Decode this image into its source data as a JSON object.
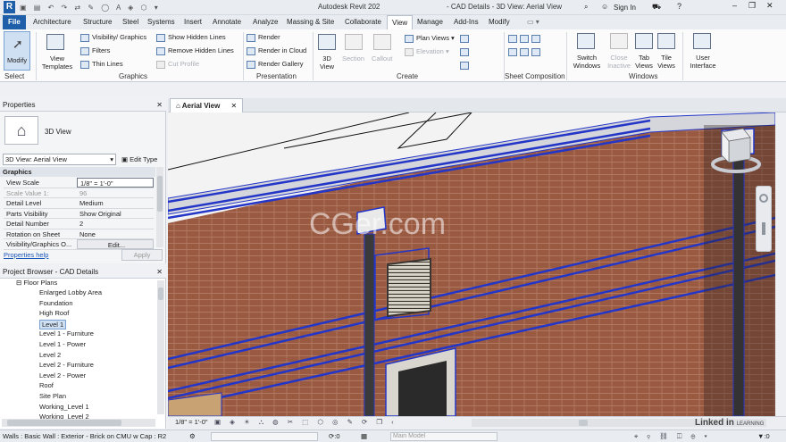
{
  "app": {
    "title": "Autodesk Revit 202",
    "doc_title": "- CAD Details - 3D View: Aerial View",
    "sign_in": "Sign In",
    "logo": "R"
  },
  "ribbon_tabs": [
    "File",
    "Architecture",
    "Structure",
    "Steel",
    "Systems",
    "Insert",
    "Annotate",
    "Analyze",
    "Massing & Site",
    "Collaborate",
    "View",
    "Manage",
    "Add-Ins",
    "Modify"
  ],
  "ribbon": {
    "modify": "Modify",
    "select": "Select",
    "view_templates": "View Templates",
    "visibility_graphics": "Visibility/ Graphics",
    "filters": "Filters",
    "thin_lines": "Thin Lines",
    "show_hidden_lines": "Show Hidden Lines",
    "remove_hidden_lines": "Remove Hidden Lines",
    "cut_profile": "Cut Profile",
    "graphics_label": "Graphics",
    "render": "Render",
    "render_in_cloud": "Render in Cloud",
    "render_gallery": "Render Gallery",
    "presentation_label": "Presentation",
    "view_3d": "3D View",
    "section": "Section",
    "callout": "Callout",
    "plan_views": "Plan Views",
    "elevation": "Elevation",
    "create_label": "Create",
    "sheet_composition_label": "Sheet Composition",
    "switch_windows": "Switch Windows",
    "close_inactive": "Close Inactive",
    "tab_views": "Tab Views",
    "tile_views": "Tile Views",
    "windows_label": "Windows",
    "user_interface": "User Interface"
  },
  "properties": {
    "title": "Properties",
    "type_name": "3D View",
    "selector": "3D View: Aerial View",
    "edit_type": "Edit Type",
    "group": "Graphics",
    "rows": [
      {
        "key": "View Scale",
        "value": "1/8\" = 1'-0\""
      },
      {
        "key": "Scale Value    1:",
        "value": "96"
      },
      {
        "key": "Detail Level",
        "value": "Medium"
      },
      {
        "key": "Parts Visibility",
        "value": "Show Original"
      },
      {
        "key": "Detail Number",
        "value": "2"
      },
      {
        "key": "Rotation on Sheet",
        "value": "None"
      },
      {
        "key": "Visibility/Graphics O...",
        "value": "Edit..."
      }
    ],
    "help": "Properties help",
    "apply": "Apply"
  },
  "browser": {
    "title": "Project Browser - CAD Details",
    "group": "Floor Plans",
    "items": [
      "Enlarged Lobby Area",
      "Foundation",
      "High Roof",
      "Level 1",
      "Level 1 - Furniture",
      "Level 1 - Power",
      "Level 2",
      "Level 2 - Furniture",
      "Level 2 - Power",
      "Roof",
      "Site Plan",
      "Working_Level 1",
      "Working_Level 2"
    ],
    "selected_index": 3
  },
  "view_tab": {
    "label": "Aerial View"
  },
  "viewport": {
    "watermark": "CGer.com"
  },
  "view_bar": {
    "scale": "1/8\" = 1'-0\""
  },
  "status": {
    "message": "Walls : Basic Wall : Exterior - Brick on CMU w Cap : R2",
    "count": ":0",
    "model": "Main Model",
    "coords": ":0"
  },
  "brand": {
    "linkedin": "Linked in",
    "learning": "LEARNING"
  },
  "colors": {
    "brand_blue": "#1f5ea8",
    "brick": "#9a5a42",
    "highlight_blue": "#2436c8"
  }
}
